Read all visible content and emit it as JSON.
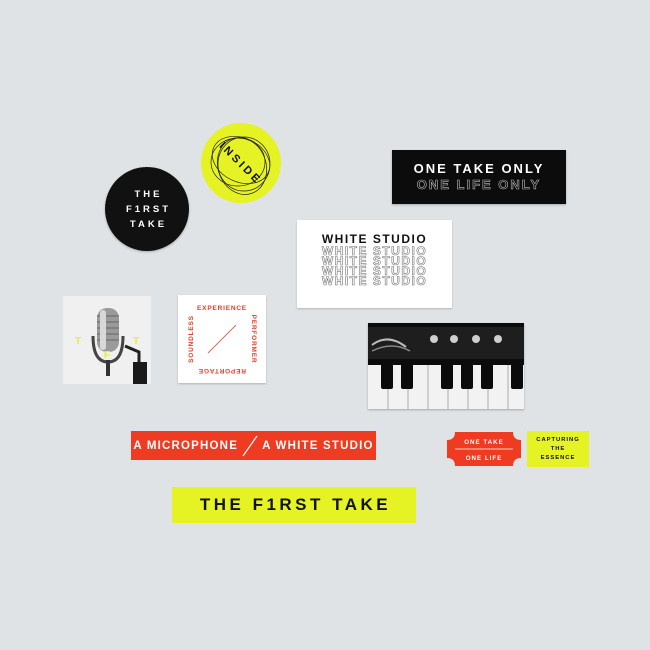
{
  "stickers": {
    "circle_logo": {
      "lines": [
        "THE",
        "F1RST",
        "TAKE"
      ]
    },
    "inside": {
      "text": "INSIDE"
    },
    "one_take_only": {
      "line1": "ONE TAKE ONLY",
      "line2": "ONE LIFE ONLY"
    },
    "white_studio": {
      "title": "WHITE STUDIO",
      "repeat": "WHITE STUDIO"
    },
    "mic_photo": {
      "letters": [
        "T",
        "F",
        "T"
      ]
    },
    "experience": {
      "top": "EXPERIENCE",
      "right": "PERFORMER",
      "bottom": "REPORTAGE",
      "left": "SOUNDLESS"
    },
    "strip": {
      "left": "A MICROPHONE",
      "right": "A WHITE STUDIO"
    },
    "red_tag": {
      "line1": "ONE TAKE",
      "line2": "ONE LIFE"
    },
    "capturing": {
      "lines": [
        "CAPTURING",
        "THE",
        "ESSENCE"
      ]
    },
    "tft_yellow": {
      "text": "THE F1RST TAKE"
    }
  },
  "colors": {
    "background": "#dfe3e5",
    "accent_yellow": "#e5f223",
    "accent_red": "#ee3b22",
    "black": "#111111"
  }
}
